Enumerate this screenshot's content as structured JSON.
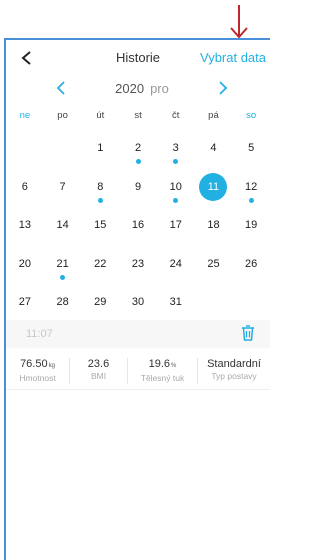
{
  "header": {
    "title": "Historie",
    "action_label": "Vybrat data"
  },
  "calendar": {
    "year": "2020",
    "month": "pro",
    "weekdays": [
      "ne",
      "po",
      "út",
      "st",
      "čt",
      "pá",
      "so"
    ],
    "weeks": [
      [
        {
          "d": ""
        },
        {
          "d": ""
        },
        {
          "d": "1"
        },
        {
          "d": "2",
          "dot": true
        },
        {
          "d": "3",
          "dot": true
        },
        {
          "d": "4"
        },
        {
          "d": "5"
        }
      ],
      [
        {
          "d": "6"
        },
        {
          "d": "7"
        },
        {
          "d": "8",
          "dot": true
        },
        {
          "d": "9"
        },
        {
          "d": "10",
          "dot": true
        },
        {
          "d": "11",
          "selected": true
        },
        {
          "d": "12",
          "dot": true
        }
      ],
      [
        {
          "d": "13"
        },
        {
          "d": "14"
        },
        {
          "d": "15"
        },
        {
          "d": "16"
        },
        {
          "d": "17"
        },
        {
          "d": "18"
        },
        {
          "d": "19"
        }
      ],
      [
        {
          "d": "20"
        },
        {
          "d": "21",
          "dot": true
        },
        {
          "d": "22"
        },
        {
          "d": "23"
        },
        {
          "d": "24"
        },
        {
          "d": "25"
        },
        {
          "d": "26"
        }
      ],
      [
        {
          "d": "27"
        },
        {
          "d": "28"
        },
        {
          "d": "29"
        },
        {
          "d": "30"
        },
        {
          "d": "31"
        },
        {
          "d": ""
        },
        {
          "d": ""
        }
      ]
    ]
  },
  "record": {
    "time": "11:07",
    "stats": [
      {
        "value": "76.50",
        "unit": "kg",
        "label": "Hmotnost"
      },
      {
        "value": "23.6",
        "unit": "",
        "label": "BMI"
      },
      {
        "value": "19.6",
        "unit": "%",
        "label": "Tělesný tuk"
      },
      {
        "value": "Standardní",
        "unit": "",
        "label": "Typ postavy"
      }
    ]
  },
  "colors": {
    "accent": "#22b0e3",
    "annotation_arrow": "#c0272d",
    "frame": "#4a90d9"
  }
}
